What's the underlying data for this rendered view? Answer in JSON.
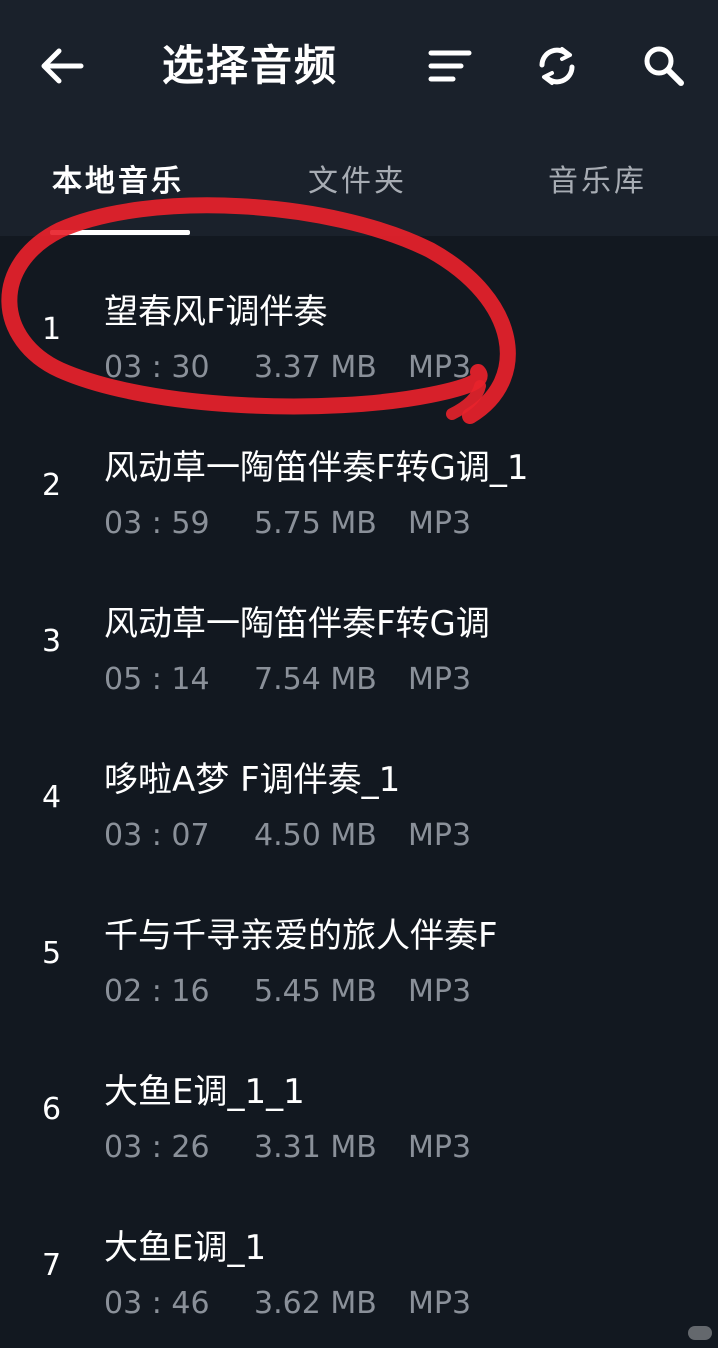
{
  "header": {
    "title": "选择音频",
    "back_icon": "arrow-left-icon",
    "sort_icon": "sort-lines-icon",
    "refresh_icon": "refresh-icon",
    "search_icon": "search-icon"
  },
  "tabs": [
    {
      "label": "本地音乐",
      "active": true
    },
    {
      "label": "文件夹",
      "active": false
    },
    {
      "label": "音乐库",
      "active": false
    }
  ],
  "tracks": [
    {
      "index": "1",
      "name": "望春风F调伴奏",
      "duration": "03 : 30",
      "size": "3.37 MB",
      "format": "MP3"
    },
    {
      "index": "2",
      "name": "风动草一陶笛伴奏F转G调_1",
      "duration": "03 : 59",
      "size": "5.75 MB",
      "format": "MP3"
    },
    {
      "index": "3",
      "name": "风动草一陶笛伴奏F转G调",
      "duration": "05 : 14",
      "size": "7.54 MB",
      "format": "MP3"
    },
    {
      "index": "4",
      "name": "哆啦A梦 F调伴奏_1",
      "duration": "03 : 07",
      "size": "4.50 MB",
      "format": "MP3"
    },
    {
      "index": "5",
      "name": "千与千寻亲爱的旅人伴奏F",
      "duration": "02 : 16",
      "size": "5.45 MB",
      "format": "MP3"
    },
    {
      "index": "6",
      "name": "大鱼E调_1_1",
      "duration": "03 : 26",
      "size": "3.31 MB",
      "format": "MP3"
    },
    {
      "index": "7",
      "name": "大鱼E调_1",
      "duration": "03 : 46",
      "size": "3.62 MB",
      "format": "MP3"
    }
  ],
  "colors": {
    "background": "#121820",
    "header_background": "#1a212b",
    "text_primary": "#ffffff",
    "text_secondary": "#8a9099",
    "tab_inactive": "#a7acb3",
    "annotation_red": "#e8222b"
  }
}
